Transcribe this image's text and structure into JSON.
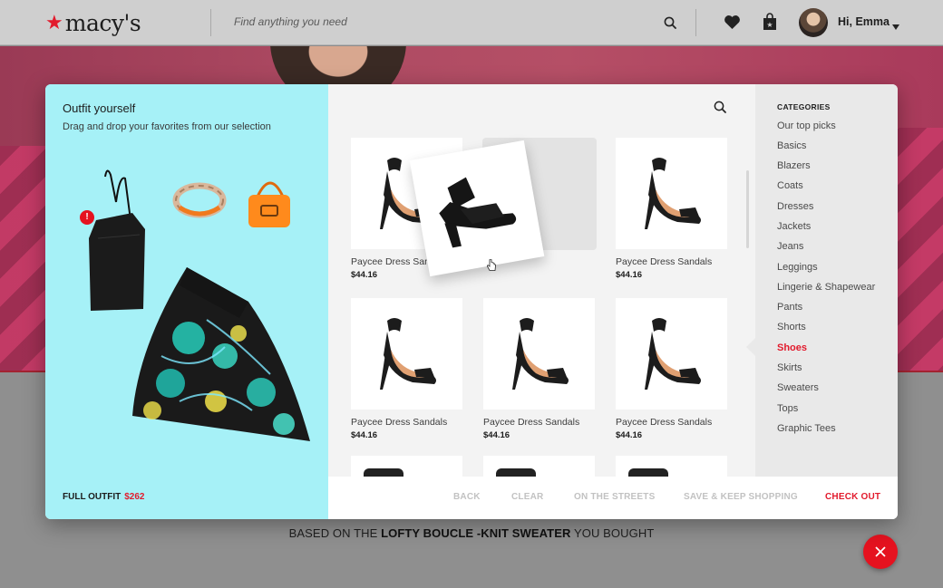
{
  "header": {
    "logo_text": "macy's",
    "search_placeholder": "Find anything you need",
    "greeting": "Hi, Emma",
    "icons": [
      "search-icon",
      "heart-icon",
      "shopping-bag-icon",
      "chevron-down-icon"
    ]
  },
  "modal": {
    "left": {
      "title": "Outfit yourself",
      "subtitle": "Drag and drop your favorites from our selection",
      "badge": "!",
      "total_label": "FULL OUTFIT",
      "total_price": "$262"
    },
    "products": [
      {
        "name": "Paycee Dress Sandals",
        "price": "$44.16"
      },
      {
        "name": "Paycee Dress Sandals",
        "price": "$44.16"
      },
      {
        "name": "Paycee Dress Sandals",
        "price": "$44.16"
      },
      {
        "name": "Paycee Dress Sandals",
        "price": "$44.16"
      },
      {
        "name": "Paycee Dress Sandals",
        "price": "$44.16"
      }
    ],
    "categories": {
      "title": "CATEGORIES",
      "items": [
        "Our top picks",
        "Basics",
        "Blazers",
        "Coats",
        "Dresses",
        "Jackets",
        "Jeans",
        "Leggings",
        "Lingerie & Shapewear",
        "Pants",
        "Shorts",
        "Shoes",
        "Skirts",
        "Sweaters",
        "Tops",
        "Graphic Tees"
      ],
      "active": "Shoes"
    },
    "footer": {
      "back": "BACK",
      "clear": "CLEAR",
      "on_the_streets": "ON THE STREETS",
      "save_keep": "SAVE & KEEP SHOPPING",
      "checkout": "CHECK OUT"
    }
  },
  "page": {
    "based_prefix": "BASED ON THE",
    "based_product": "LOFTY BOUCLE -KNIT SWEATER",
    "based_suffix": "YOU BOUGHT"
  },
  "colors": {
    "accent": "#e21a2c",
    "left_panel": "#a6f1f7"
  }
}
